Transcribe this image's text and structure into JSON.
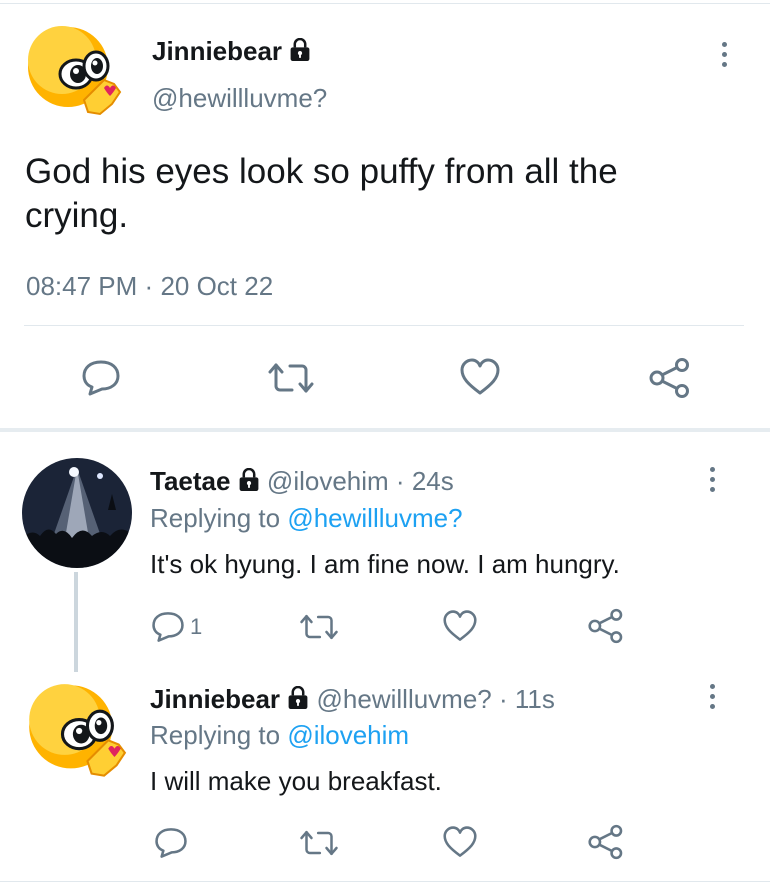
{
  "main_tweet": {
    "display_name": "Jinniebear",
    "handle": "@hewillluvme?",
    "text_line1": "God his eyes look so puffy from all the",
    "text_line2": "crying.",
    "time": "08:47 PM",
    "separator": "·",
    "date": "20 Oct 22",
    "avatar": "emoji-style-avatar"
  },
  "replies": [
    {
      "display_name": "Taetae",
      "handle": "@ilovehim",
      "separator": "·",
      "age": "24s",
      "replying_prefix": "Replying to",
      "replying_handle": "@hewillluvme?",
      "text": "It's ok hyung. I am fine now. I am hungry.",
      "reply_count": "1",
      "avatar": "concert-photo-avatar"
    },
    {
      "display_name": "Jinniebear",
      "handle": "@hewillluvme?",
      "separator": "·",
      "age": "11s",
      "replying_prefix": "Replying to",
      "replying_handle": "@ilovehim",
      "text": "I will make you breakfast.",
      "reply_count": "",
      "avatar": "emoji-style-avatar"
    }
  ],
  "colors": {
    "text": "#14171a",
    "secondary": "#657786",
    "link": "#1da1f2",
    "divider": "#e1e8ed",
    "avatar_yellow": "#ffb800"
  },
  "icons": [
    "lock-icon",
    "reply-icon",
    "retweet-icon",
    "like-icon",
    "share-icon",
    "more-icon"
  ]
}
